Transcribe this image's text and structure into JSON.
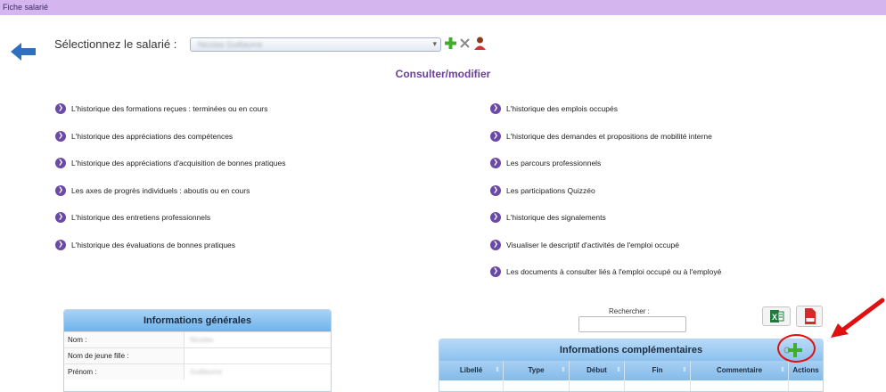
{
  "topbar": {
    "title": "Fiche salarié"
  },
  "selector": {
    "label": "Sélectionnez le salarié :",
    "value": "Nicolas Guillaume"
  },
  "section_title": "Consulter/modifier",
  "links_left": [
    "L'historique des formations reçues : terminées ou en cours",
    "L'historique des appréciations des compétences",
    "L'historique des appréciations d'acquisition de bonnes pratiques",
    "Les axes de progrès individuels : aboutis ou en cours",
    "L'historique des entretiens professionnels",
    "L'historique des évaluations de bonnes pratiques"
  ],
  "links_right": [
    "L'historique des emplois occupés",
    "L'historique des demandes et propositions de mobilité interne",
    "Les parcours professionnels",
    "Les participations Quizzéo",
    "L'historique des signalements",
    "Visualiser le descriptif d'activités de l'emploi occupé",
    "Les documents à consulter liés à l'emploi occupé ou à l'employé"
  ],
  "info_general": {
    "title": "Informations générales",
    "rows": [
      {
        "label": "Nom :",
        "value": "Nicolas"
      },
      {
        "label": "Nom de jeune fille :",
        "value": ""
      },
      {
        "label": "Prénom :",
        "value": "Guillaume"
      }
    ]
  },
  "search": {
    "label": "Rechercher :",
    "value": ""
  },
  "info_comp": {
    "title": "Informations complémentaires",
    "columns": [
      "Libellé",
      "Type",
      "Début",
      "Fin",
      "Commentaire",
      "Actions"
    ]
  },
  "colors": {
    "topbar": "#d4b5ee",
    "accent_purple": "#6b3fa0",
    "header_blue": "#6db3ec",
    "highlight_red": "#e01010"
  }
}
